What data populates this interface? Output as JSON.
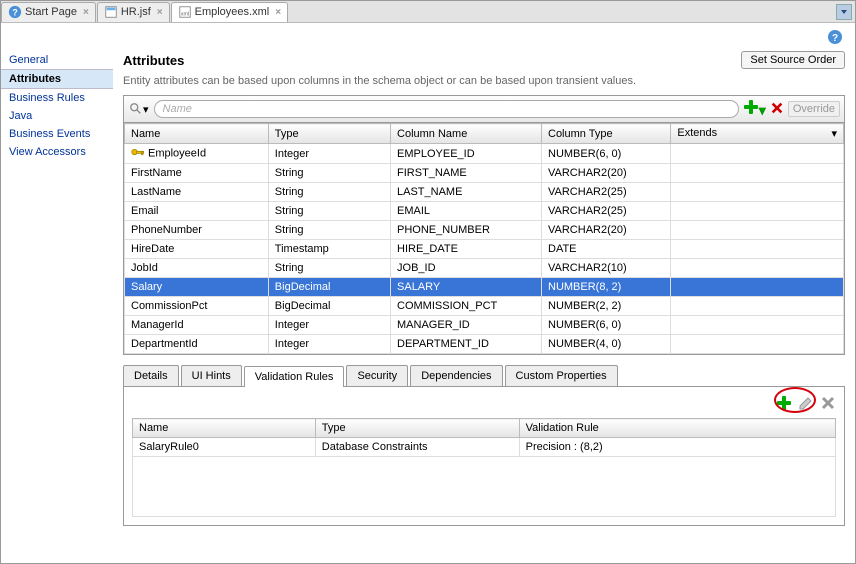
{
  "tabs": [
    {
      "label": "Start Page",
      "icon": "question-blue-icon"
    },
    {
      "label": "HR.jsf",
      "icon": "jsf-page-icon"
    },
    {
      "label": "Employees.xml",
      "icon": "xml-file-icon",
      "active": true
    }
  ],
  "sidebar": {
    "items": [
      {
        "label": "General"
      },
      {
        "label": "Attributes",
        "active": true
      },
      {
        "label": "Business Rules"
      },
      {
        "label": "Java"
      },
      {
        "label": "Business Events"
      },
      {
        "label": "View Accessors"
      }
    ]
  },
  "page": {
    "title": "Attributes",
    "description": "Entity attributes can be based upon columns in the schema object or can be based upon transient values.",
    "set_source_order": "Set Source Order",
    "search_placeholder": "Name",
    "override": "Override"
  },
  "columns": [
    "Name",
    "Type",
    "Column Name",
    "Column Type",
    "Extends"
  ],
  "rows": [
    {
      "name": "EmployeeId",
      "type": "Integer",
      "col": "EMPLOYEE_ID",
      "ctype": "NUMBER(6, 0)",
      "ext": "",
      "key": true
    },
    {
      "name": "FirstName",
      "type": "String",
      "col": "FIRST_NAME",
      "ctype": "VARCHAR2(20)",
      "ext": ""
    },
    {
      "name": "LastName",
      "type": "String",
      "col": "LAST_NAME",
      "ctype": "VARCHAR2(25)",
      "ext": ""
    },
    {
      "name": "Email",
      "type": "String",
      "col": "EMAIL",
      "ctype": "VARCHAR2(25)",
      "ext": ""
    },
    {
      "name": "PhoneNumber",
      "type": "String",
      "col": "PHONE_NUMBER",
      "ctype": "VARCHAR2(20)",
      "ext": ""
    },
    {
      "name": "HireDate",
      "type": "Timestamp",
      "col": "HIRE_DATE",
      "ctype": "DATE",
      "ext": ""
    },
    {
      "name": "JobId",
      "type": "String",
      "col": "JOB_ID",
      "ctype": "VARCHAR2(10)",
      "ext": ""
    },
    {
      "name": "Salary",
      "type": "BigDecimal",
      "col": "SALARY",
      "ctype": "NUMBER(8, 2)",
      "ext": "",
      "selected": true
    },
    {
      "name": "CommissionPct",
      "type": "BigDecimal",
      "col": "COMMISSION_PCT",
      "ctype": "NUMBER(2, 2)",
      "ext": ""
    },
    {
      "name": "ManagerId",
      "type": "Integer",
      "col": "MANAGER_ID",
      "ctype": "NUMBER(6, 0)",
      "ext": ""
    },
    {
      "name": "DepartmentId",
      "type": "Integer",
      "col": "DEPARTMENT_ID",
      "ctype": "NUMBER(4, 0)",
      "ext": ""
    }
  ],
  "subtabs": [
    "Details",
    "UI Hints",
    "Validation Rules",
    "Security",
    "Dependencies",
    "Custom Properties"
  ],
  "active_subtab": "Validation Rules",
  "valcolumns": [
    "Name",
    "Type",
    "Validation Rule"
  ],
  "valrows": [
    {
      "name": "SalaryRule0",
      "type": "Database Constraints",
      "rule": "Precision : (8,2)"
    }
  ]
}
